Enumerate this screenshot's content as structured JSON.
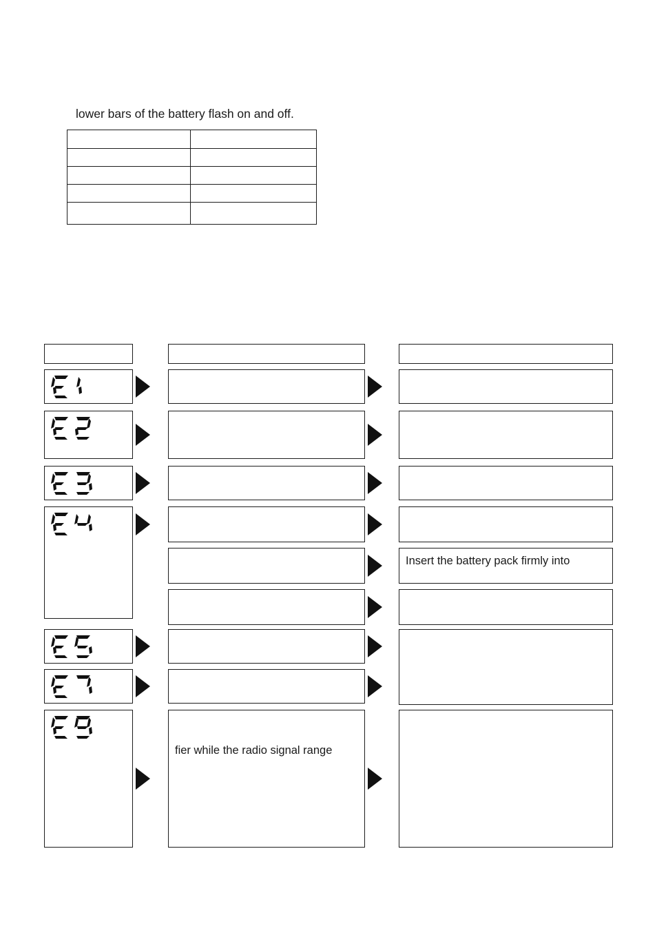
{
  "document": {
    "intro_text": "lower bars of the battery flash on and off."
  },
  "spec_table": {
    "rows": [
      {
        "col1": "",
        "col2": ""
      },
      {
        "col1": "",
        "col2": ""
      },
      {
        "col1": "",
        "col2": ""
      },
      {
        "col1": "",
        "col2": ""
      },
      {
        "col1": "",
        "col2": ""
      }
    ]
  },
  "flow": {
    "header": {
      "code_col": "",
      "cause_col": "",
      "action_col": ""
    },
    "rows": [
      {
        "code": "E1",
        "cause": "",
        "action": ""
      },
      {
        "code": "E2",
        "cause": "",
        "action": ""
      },
      {
        "code": "E3",
        "cause": "",
        "action": ""
      },
      {
        "code": "E4",
        "cause": "",
        "action": ""
      },
      {
        "code": "",
        "cause": "",
        "action": "Insert the battery pack firmly into"
      },
      {
        "code": "",
        "cause": "",
        "action": ""
      },
      {
        "code": "E5",
        "cause": "",
        "action": ""
      },
      {
        "code": "E7",
        "cause": "",
        "action": ""
      },
      {
        "code": "E9",
        "cause": "fier while the radio signal range",
        "action": ""
      }
    ]
  },
  "icons": {
    "arrow": "right-triangle-arrow",
    "lcd": "seven-segment-display"
  },
  "colors": {
    "ink": "#1c1c1c",
    "text": "#1a1a1a",
    "paper": "#ffffff"
  }
}
